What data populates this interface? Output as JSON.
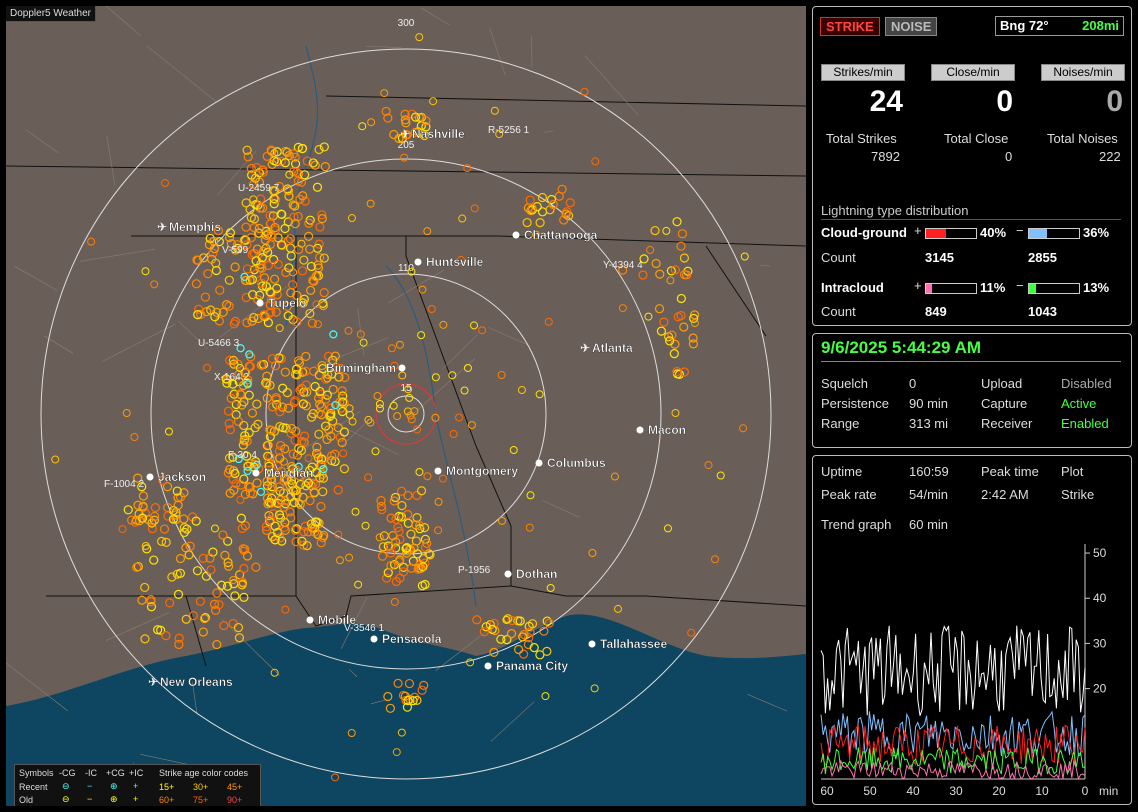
{
  "map": {
    "title": "Doppler5 Weather",
    "range_labels": [
      "300",
      "205",
      "110",
      "15"
    ],
    "cities": [
      {
        "name": "Nashville",
        "kind": "airport"
      },
      {
        "name": "Memphis",
        "kind": "airport"
      },
      {
        "name": "Chattanooga",
        "kind": "dot"
      },
      {
        "name": "Huntsville",
        "kind": "dot"
      },
      {
        "name": "Tupelo",
        "kind": "dot"
      },
      {
        "name": "Birmingham",
        "kind": "dot"
      },
      {
        "name": "Atlanta",
        "kind": "airport"
      },
      {
        "name": "Macon",
        "kind": "dot"
      },
      {
        "name": "Jackson",
        "kind": "dot"
      },
      {
        "name": "Meridian",
        "kind": "dot"
      },
      {
        "name": "Montgomery",
        "kind": "dot"
      },
      {
        "name": "Columbus",
        "kind": "dot"
      },
      {
        "name": "Dothan",
        "kind": "dot"
      },
      {
        "name": "Mobile",
        "kind": "dot"
      },
      {
        "name": "Pensacola",
        "kind": "dot"
      },
      {
        "name": "Tallahassee",
        "kind": "dot"
      },
      {
        "name": "Panama City",
        "kind": "dot"
      },
      {
        "name": "New Orleans",
        "kind": "airport"
      }
    ],
    "storm_tags": [
      "R-5256 1",
      "U-2459 7",
      "V-599",
      "Y-4394 4",
      "U-5466 3",
      "X-164 2",
      "F-30 4",
      "F-1004 2",
      "P-1956",
      "V-3546 1"
    ],
    "legend": {
      "symbols_label": "Symbols",
      "types": [
        "-CG",
        "-IC",
        "+CG",
        "+IC"
      ],
      "age_title": "Strike age color codes",
      "recent_label": "Recent",
      "old_label": "Old",
      "recent_ages": [
        "15+",
        "30+",
        "45+"
      ],
      "old_ages": [
        "60+",
        "75+",
        "90+"
      ]
    }
  },
  "status": {
    "strike_button": "STRIKE",
    "noise_button": "NOISE",
    "bearing": "Bng 72°",
    "distance": "208mi",
    "headers": [
      "Strikes/min",
      "Close/min",
      "Noises/min"
    ],
    "rates": [
      "24",
      "0",
      "0"
    ],
    "total_labels": [
      "Total Strikes",
      "Total Close",
      "Total Noises"
    ],
    "totals": [
      "7892",
      "0",
      "222"
    ],
    "dist_title": "Lightning type distribution",
    "cg_label": "Cloud-ground",
    "ic_label": "Intracloud",
    "count_label": "Count",
    "cg_pos_pct": "40%",
    "cg_neg_pct": "36%",
    "cg_pos_count": "3145",
    "cg_neg_count": "2855",
    "ic_pos_pct": "11%",
    "ic_neg_pct": "13%",
    "ic_pos_count": "849",
    "ic_neg_count": "1043",
    "cg_pos_fill": 0.4,
    "cg_neg_fill": 0.36,
    "ic_pos_fill": 0.11,
    "ic_neg_fill": 0.13
  },
  "settings": {
    "datetime": "9/6/2025 5:44:29 AM",
    "squelch_label": "Squelch",
    "squelch": "0",
    "persistence_label": "Persistence",
    "persistence": "90 min",
    "range_label": "Range",
    "range": "313 mi",
    "upload_label": "Upload",
    "upload": "Disabled",
    "capture_label": "Capture",
    "capture": "Active",
    "receiver_label": "Receiver",
    "receiver": "Enabled"
  },
  "stats": {
    "uptime_label": "Uptime",
    "uptime": "160:59",
    "peak_time_label": "Peak time",
    "peak_time": "2:42 AM",
    "plot_label": "Plot",
    "plot": "Strike",
    "peak_rate_label": "Peak rate",
    "peak_rate": "54/min",
    "trend_label": "Trend graph",
    "trend": "60 min",
    "x_ticks": [
      "60",
      "50",
      "40",
      "30",
      "20",
      "10",
      "0"
    ],
    "x_unit": "min",
    "y_ticks": [
      "50",
      "40",
      "30",
      "20"
    ]
  },
  "colors": {
    "cg_pos": "#ff2020",
    "cg_neg": "#80c0ff",
    "ic_pos": "#ff70b0",
    "ic_neg": "#40ff40",
    "accent_green": "#44ff44"
  }
}
